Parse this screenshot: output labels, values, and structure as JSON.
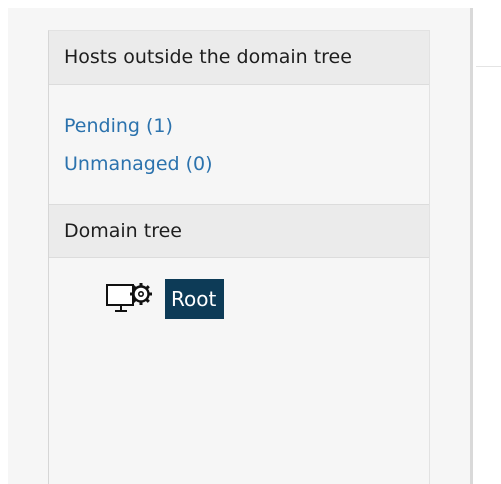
{
  "sections": {
    "outside": {
      "title": "Hosts outside the domain tree",
      "links": {
        "pending": "Pending (1)",
        "unmanaged": "Unmanaged (0)"
      }
    },
    "domain": {
      "title": "Domain tree",
      "root_node": {
        "label": "Root",
        "icon": "managed-host-gear-icon",
        "selected": true
      }
    }
  },
  "colors": {
    "link": "#2b72ad",
    "selection_bg": "#0d3b57",
    "header_bg": "#ebebeb",
    "panel_bg": "#f6f6f6"
  }
}
